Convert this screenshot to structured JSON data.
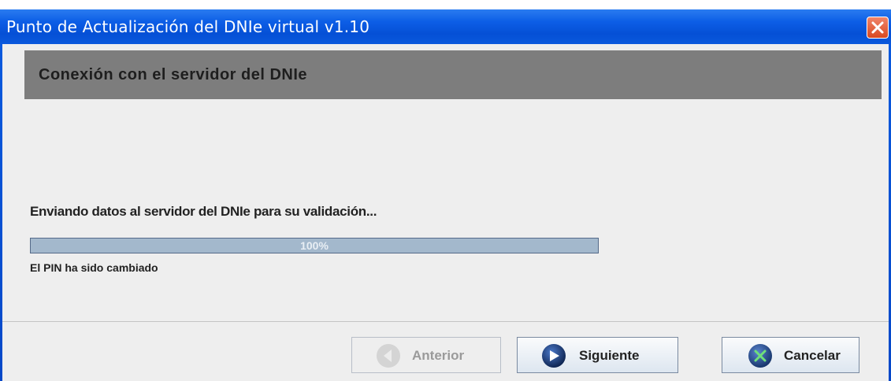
{
  "window": {
    "title": "Punto de Actualización del DNIe virtual v1.10"
  },
  "header": {
    "title": "Conexión con el servidor del DNIe"
  },
  "main": {
    "status_message": "Enviando datos al servidor del DNIe para su validación...",
    "progress": {
      "value": 100,
      "label": "100%"
    },
    "result_message": "El PIN ha sido cambiado"
  },
  "buttons": {
    "previous": {
      "label": "Anterior",
      "enabled": false,
      "icon": "arrow-left-icon"
    },
    "next": {
      "label": "Siguiente",
      "enabled": true,
      "icon": "arrow-right-icon"
    },
    "cancel": {
      "label": "Cancelar",
      "enabled": true,
      "icon": "cancel-x-icon"
    }
  },
  "colors": {
    "titlebar": "#0550d6",
    "header_panel": "#7d7d7d",
    "progress_fill": "#a3b8cc",
    "close_button": "#d9481f"
  }
}
